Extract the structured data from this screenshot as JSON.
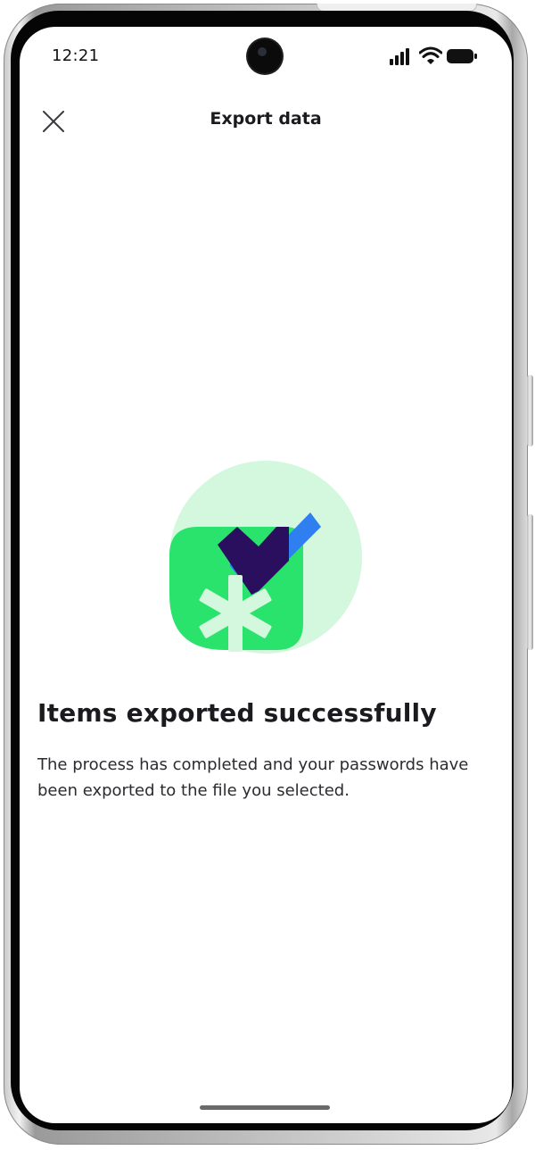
{
  "status_bar": {
    "time": "12:21",
    "icons": [
      "signal-icon",
      "wifi-icon",
      "battery-icon"
    ]
  },
  "app_bar": {
    "close_icon": "close-icon",
    "title": "Export data"
  },
  "content": {
    "illustration": "export-success-illustration",
    "headline": "Items exported successfully",
    "body": "The process has completed and your passwords have been exported to the file you selected."
  },
  "colors": {
    "illustration_circle": "#d3f8dd",
    "illustration_square": "#2ae36c",
    "check_blue": "#2f7ff0",
    "check_navy": "#2a0f5e",
    "asterisk": "#d3f8dd"
  }
}
